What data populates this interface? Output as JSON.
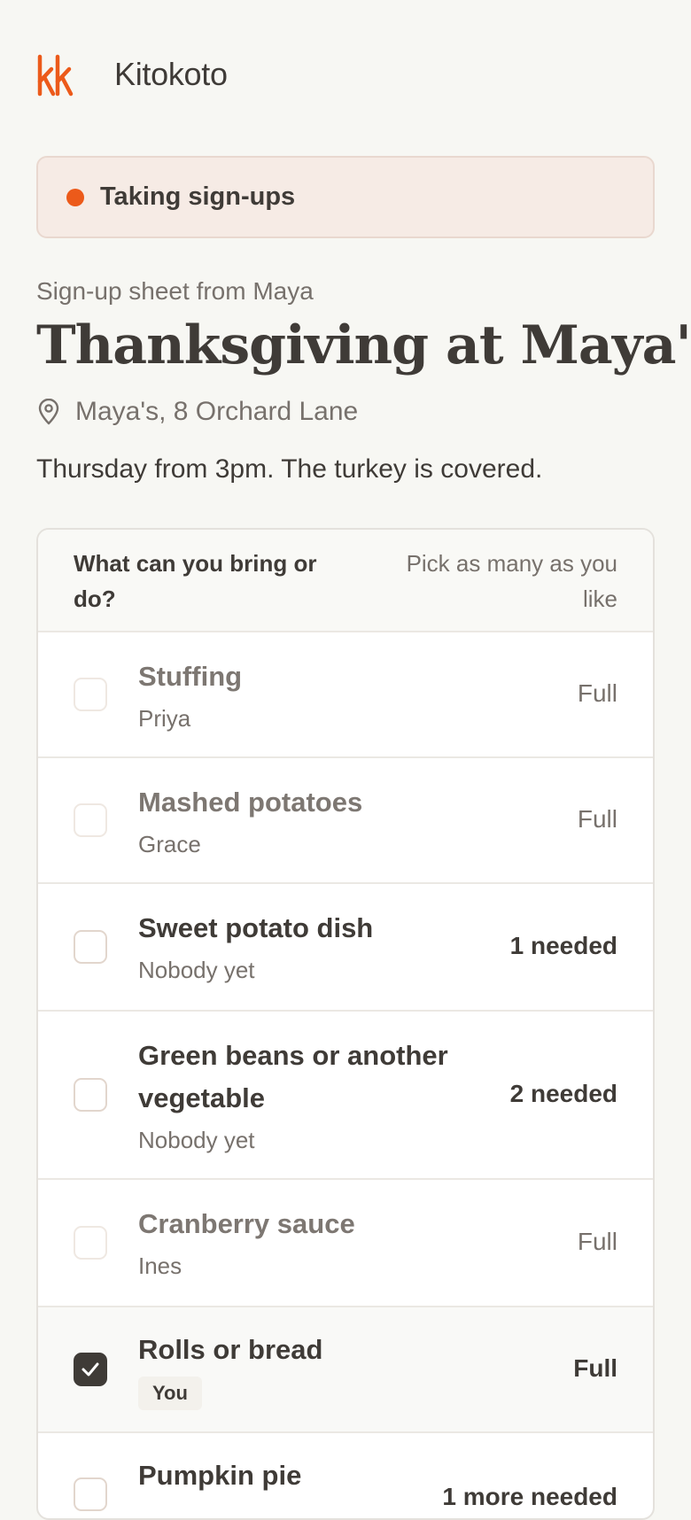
{
  "brand": {
    "name": "Kitokoto",
    "logo_text": "kk",
    "accent_color": "#ec5a1a"
  },
  "status": {
    "label": "Taking sign-ups",
    "color": "#ec5a1a"
  },
  "sheet": {
    "eyebrow": "Sign-up sheet from Maya",
    "title": "Thanksgiving at Maya's",
    "location_icon": "location-pin-icon",
    "location": "Maya's, 8 Orchard Lane",
    "description": "Thursday from 3pm. The turkey is covered."
  },
  "list": {
    "question": "What can you bring or do?",
    "hint": "Pick as many as you like",
    "items": [
      {
        "name": "Stuffing",
        "who": "Priya",
        "status": "Full",
        "state": "full",
        "checked": false
      },
      {
        "name": "Mashed potatoes",
        "who": "Grace",
        "status": "Full",
        "state": "full",
        "checked": false
      },
      {
        "name": "Sweet potato dish",
        "who": "Nobody yet",
        "status": "1 needed",
        "state": "needed",
        "checked": false
      },
      {
        "name": "Green beans or another vegetable",
        "who": "Nobody yet",
        "status": "2 needed",
        "state": "needed",
        "checked": false
      },
      {
        "name": "Cranberry sauce",
        "who": "Ines",
        "status": "Full",
        "state": "full",
        "checked": false
      },
      {
        "name": "Rolls or bread",
        "who": "You",
        "status": "Full",
        "state": "selected",
        "checked": true
      },
      {
        "name": "Pumpkin pie",
        "who": "",
        "status": "1 more needed",
        "state": "needed",
        "checked": false
      }
    ]
  }
}
